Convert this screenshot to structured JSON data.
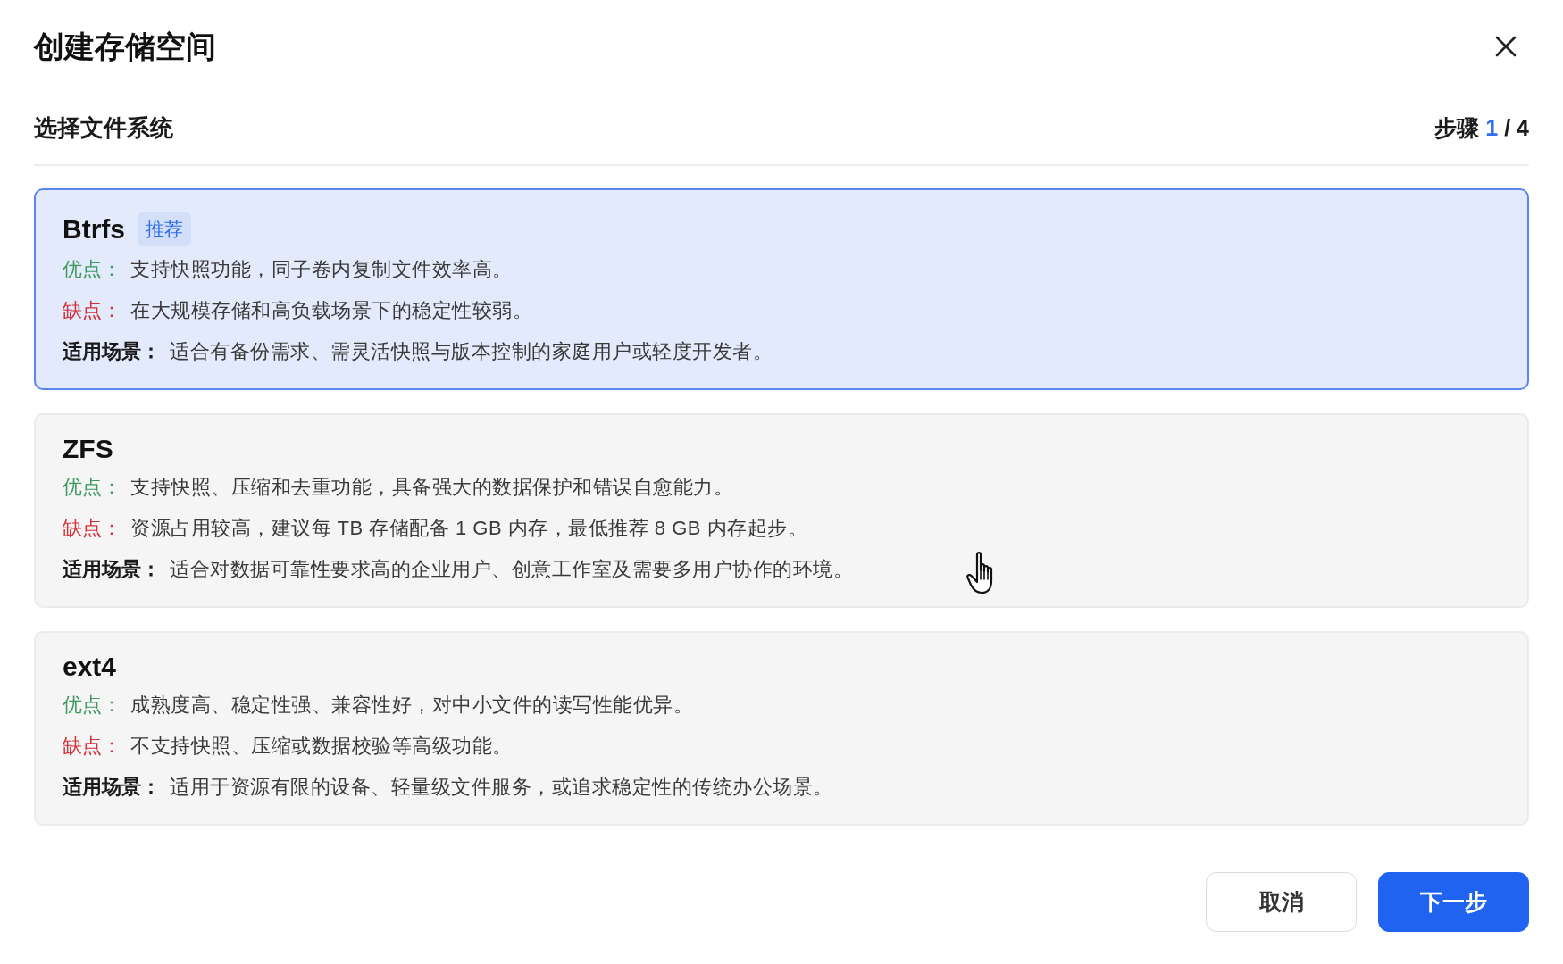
{
  "dialog": {
    "title": "创建存储空间",
    "step_title": "选择文件系统",
    "step": {
      "label": "步骤",
      "current": "1",
      "separator": "/",
      "total": "4"
    }
  },
  "options": [
    {
      "name": "Btrfs",
      "badge": "推荐",
      "selected": true,
      "rows": [
        {
          "kind": "pros",
          "label": "优点：",
          "text": "支持快照功能，同子卷内复制文件效率高。"
        },
        {
          "kind": "cons",
          "label": "缺点：",
          "text": "在大规模存储和高负载场景下的稳定性较弱。"
        },
        {
          "kind": "usage",
          "label": "适用场景：",
          "text": "适合有备份需求、需灵活快照与版本控制的家庭用户或轻度开发者。"
        }
      ]
    },
    {
      "name": "ZFS",
      "selected": false,
      "rows": [
        {
          "kind": "pros",
          "label": "优点：",
          "text": "支持快照、压缩和去重功能，具备强大的数据保护和错误自愈能力。"
        },
        {
          "kind": "cons",
          "label": "缺点：",
          "text": "资源占用较高，建议每 TB 存储配备 1 GB 内存，最低推荐 8 GB 内存起步。"
        },
        {
          "kind": "usage",
          "label": "适用场景：",
          "text": "适合对数据可靠性要求高的企业用户、创意工作室及需要多用户协作的环境。"
        }
      ]
    },
    {
      "name": "ext4",
      "selected": false,
      "rows": [
        {
          "kind": "pros",
          "label": "优点：",
          "text": "成熟度高、稳定性强、兼容性好，对中小文件的读写性能优异。"
        },
        {
          "kind": "cons",
          "label": "缺点：",
          "text": "不支持快照、压缩或数据校验等高级功能。"
        },
        {
          "kind": "usage",
          "label": "适用场景：",
          "text": "适用于资源有限的设备、轻量级文件服务，或追求稳定性的传统办公场景。"
        }
      ]
    }
  ],
  "buttons": [
    {
      "kind": "secondary",
      "label": "取消"
    },
    {
      "kind": "primary",
      "label": "下一步"
    }
  ]
}
